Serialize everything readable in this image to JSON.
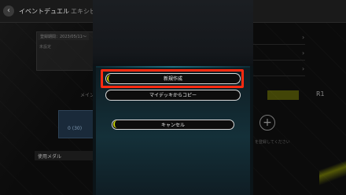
{
  "header": {
    "back_icon": "chevron-left-icon",
    "title": "イベントデュエル",
    "title_tab2": "エキシビ"
  },
  "background_left": {
    "date_badge": "登録期間：2023/05/11～",
    "tag_label": "未設定",
    "deck_count": "0 (30)",
    "side_label": "メイン",
    "list_header": "使用メダル"
  },
  "background_right": {
    "tab_r1": "R1",
    "plus_icon": "plus-icon",
    "hint_text": "を登録してください"
  },
  "modal": {
    "new_button": "新規作成",
    "copy_button": "マイデッキからコピー",
    "cancel_button": "キャンセル"
  },
  "colors": {
    "accent": "#c9d400",
    "highlight": "#ff2a10",
    "modal_teal": "#143039"
  }
}
